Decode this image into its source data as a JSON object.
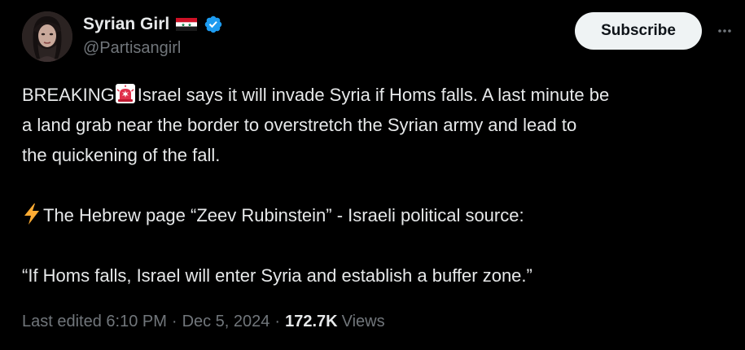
{
  "author": {
    "display_name": "Syrian Girl",
    "handle": "@Partisangirl",
    "flag_icon": "syria-flag-icon",
    "verified_icon": "verified-badge-icon",
    "verified_color": "#1d9bf0"
  },
  "actions": {
    "subscribe_label": "Subscribe",
    "more_icon": "more-horizontal-icon"
  },
  "tweet": {
    "line1_prefix": "BREAKING",
    "line1_emoji": "siren-icon",
    "line1_rest": "Israel says it will invade Syria if Homs falls. A last minute be",
    "line2": "a land grab near the border to overstretch the Syrian army and lead to",
    "line3": "the quickening of the fall.",
    "line4_emoji": "lightning-icon",
    "line4": "The Hebrew page “Zeev Rubinstein” - Israeli political source:",
    "line5": "“If Homs falls, Israel will enter Syria and establish a buffer zone.”"
  },
  "meta": {
    "edited": "Last edited 6:10 PM",
    "date": "Dec 5, 2024",
    "views_count": "172.7K",
    "views_label": "Views"
  },
  "colors": {
    "background": "#000000",
    "text": "#e7e9ea",
    "secondary": "#71767b",
    "button_bg": "#eff3f4"
  }
}
